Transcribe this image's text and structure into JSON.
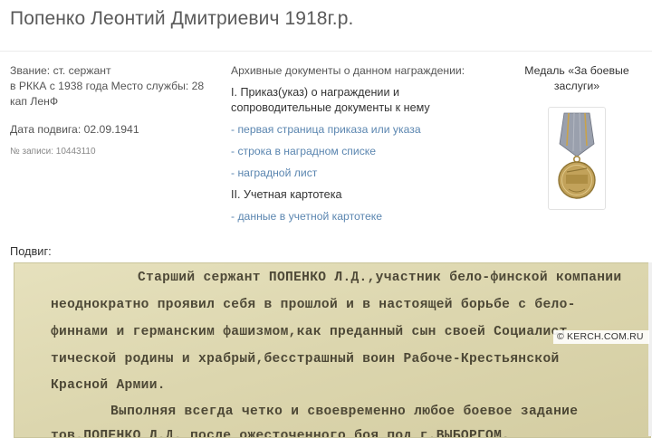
{
  "header": {
    "title": "Попенко Леонтий Дмитриевич 1918г.р."
  },
  "person": {
    "rank_line": "Звание: ст. сержант",
    "service_line1": "в РККА с 1938 года Место службы: 28",
    "service_line2": "кап ЛенФ",
    "feat_date": "Дата подвига: 02.09.1941",
    "record_no": "№ записи: 10443110"
  },
  "archive": {
    "header": "Архивные документы о данном награждении:",
    "section1_line1": "I. Приказ(указ) о награждении и",
    "section1_line2": "сопроводительные документы к нему",
    "links1": [
      "- первая страница приказа или указа",
      "- строка в наградном списке",
      "- наградной лист"
    ],
    "section2": "II. Учетная картотека",
    "links2": [
      "- данные в учетной картотеке"
    ]
  },
  "award": {
    "line1": "Медаль «За боевые",
    "line2": "заслуги»",
    "icon": "medal-combat-merit-icon"
  },
  "deed": {
    "label": "Подвиг:",
    "lines": [
      "Старший сержант ПОПЕНКО Л.Д.,участник бело-финской компании",
      "неоднократно проявил себя в прошлой и в настоящей борьбе с бело-",
      "финнами и германским фашизмом,как преданный сын своей Социалист",
      "тической родины и храбрый,бесстрашный воин Рабоче-Крестьянской",
      "Красной Армии.",
      "Выполняя всегда четко и своевременно любое боевое задание",
      "тов.ПОПЕНКО Л.Д. после ожесточенного боя под г.ВЫБОРГОМ,"
    ]
  },
  "watermark": {
    "text": "© KERCH.COM.RU"
  },
  "colors": {
    "link": "#5b86b0",
    "paper": "#ded9b4",
    "ribbon": "#9aa0ad",
    "medal_metal": "#c2a25a"
  }
}
